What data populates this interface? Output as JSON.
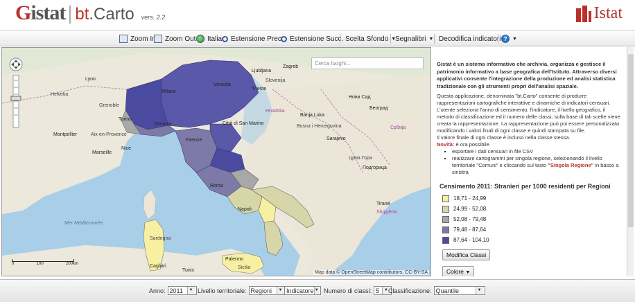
{
  "header": {
    "logo_g": "G",
    "logo_istat": "istat",
    "logo_bt": "bt",
    "logo_carto": ".Carto",
    "version": "vers. 2.2",
    "brand": "Istat"
  },
  "toolbar": {
    "zoom_in": "Zoom In",
    "zoom_out": "Zoom Out",
    "italia": "Italia",
    "extent_prev": "Estensione Prec.",
    "extent_next": "Estensione Succ.",
    "background": "Scelta Sfondo",
    "bookmarks": "Segnalibri",
    "decode": "Decodifica indicatori"
  },
  "map": {
    "search_placeholder": "Cerca luoghi...",
    "attribution": "Map data © OpenStreetMap contributors, CC-BY-SA",
    "scale": {
      "zero": "0",
      "mid": "100",
      "end": "200km"
    },
    "labels": {
      "helvetia": "Helvetia",
      "grenoble": "Grenoble",
      "lyon": "Lyon",
      "torino": "Torino",
      "genova": "Genova",
      "milano": "Milano",
      "venezia": "Venezia",
      "trieste": "Trieste",
      "ljubljana": "Ljubljana",
      "slovenija": "Slovenija",
      "zagreb": "Zagreb",
      "hrvatska": "Hrvatska",
      "bosna": "Bosna i Hercegovina",
      "banja_luka": "Banja Luka",
      "sarajevo": "Sarajevo",
      "novi_sad": "Нови Сад",
      "beograd": "Београд",
      "srbija": "Србија",
      "crna_gora": "Црна Гора",
      "podgorica": "Подгорица",
      "nice": "Nice",
      "marseille": "Marseille",
      "aix": "Aix-en-Provence",
      "montpellier": "Montpellier",
      "firenze": "Firenze",
      "san_marino": "Città di San Marino",
      "roma": "Roma",
      "napoli": "Napoli",
      "palermo": "Palermo",
      "cagliari": "Cagliari",
      "sardegna": "Sardegna",
      "sicilia": "Sicilia",
      "tunis": "Tunis",
      "tirana": "Tiranë",
      "shqiperia": "Shqipëria",
      "mer_med": "Mer Méditerranée"
    }
  },
  "panel": {
    "intro": "Gistat è un sistema informativo che archivia, organizza e gestisce il patrimonio informativo a base geografica dell'Istituto. Attraverso diversi applicativi consente l'integrazione della produzione ed analisi statistica tradizionale con gli strumenti propri dell'analisi spaziale.",
    "body": "Questa applicazione, denominata \"bt.Carto\" consente di produrre rappresentazioni cartografiche interattive e dinamiche di indicatori censuari. L'utente seleziona l'anno di censimento, l'indicatore, il livello geografico, il metodo di classificazione ed il numero delle classi, sulla base di tali scelte viene creata la rappresentazione. La rappresentazione può poi essere personalizzata modificando i valori finali di ogni classe e quindi stampata su file.",
    "body2": "Il valore finale di ogni classe è incluso nella classe stessa.",
    "novita_label": "Novità:",
    "novita_text": "è ora possibile",
    "bullet1": "esportare i dati censuari in file CSV",
    "bullet2_pre": "realizzare cartogrammi per singola regione, selezionando il livello territoriale \"Comuni\" e cliccando sul tasto ",
    "bullet2_red": "\"Singola Regione\"",
    "bullet2_post": " in basso a sinistra",
    "legend_title": "Censimento 2011: Stranieri per 1000 residenti per Regioni",
    "legend": [
      {
        "label": "18,71 - 24,99",
        "color": "#f7f0a3"
      },
      {
        "label": "24,99 - 52,08",
        "color": "#d6d6a8"
      },
      {
        "label": "52,08 - 79,48",
        "color": "#a8a8a8"
      },
      {
        "label": "79,48 - 87,64",
        "color": "#7d7aa8"
      },
      {
        "label": "87,64 - 104,10",
        "color": "#4a4aa0"
      }
    ],
    "modify_button": "Modifica Classi",
    "colors_button": "Colore"
  },
  "bottombar": {
    "anno_label": "Anno:",
    "anno_value": "2011",
    "livello_label": "Livello territoriale:",
    "livello_value": "Regioni",
    "indicatore_value": "Indicatore",
    "num_classi_label": "Numero di classi:",
    "num_classi_value": "5",
    "classificazione_label": "Classificazione:",
    "classificazione_value": "Quantile"
  }
}
